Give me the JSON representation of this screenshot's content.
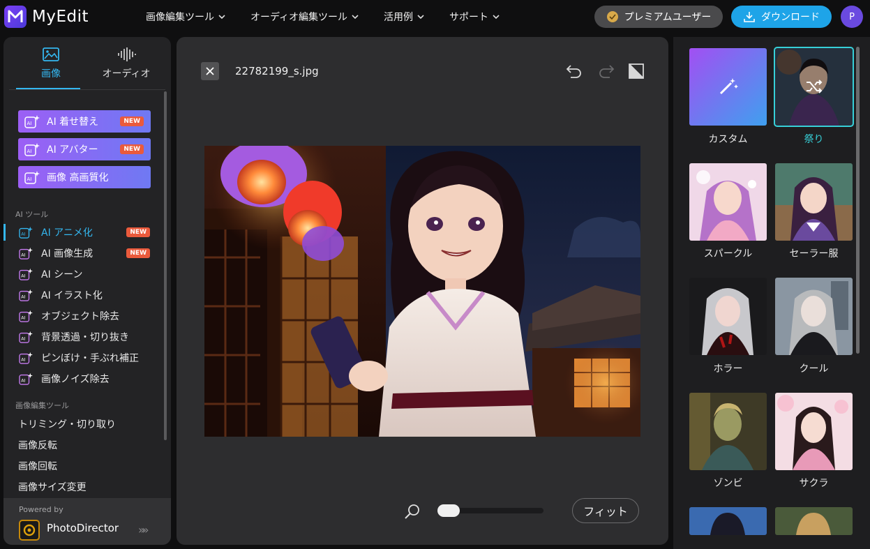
{
  "app": {
    "name": "MyEdit"
  },
  "nav": {
    "items": [
      {
        "label": "画像編集ツール"
      },
      {
        "label": "オーディオ編集ツール"
      },
      {
        "label": "活用例"
      },
      {
        "label": "サポート"
      }
    ],
    "premium_label": "プレミアムユーザー",
    "download_label": "ダウンロード",
    "avatar_initial": "P"
  },
  "sidebar": {
    "tabs": [
      {
        "label": "画像"
      },
      {
        "label": "オーディオ"
      }
    ],
    "featured": [
      {
        "label": "AI 着せ替え",
        "badge": "NEW"
      },
      {
        "label": "AI アバター",
        "badge": "NEW"
      },
      {
        "label": "画像 高画質化"
      }
    ],
    "ai_tools_label": "AI ツール",
    "ai_tools": [
      {
        "label": "AI アニメ化",
        "badge": "NEW"
      },
      {
        "label": "AI 画像生成",
        "badge": "NEW"
      },
      {
        "label": "AI シーン"
      },
      {
        "label": "AI イラスト化"
      },
      {
        "label": "オブジェクト除去"
      },
      {
        "label": "背景透過・切り抜き"
      },
      {
        "label": "ピンぼけ・手ぶれ補正"
      },
      {
        "label": "画像ノイズ除去"
      }
    ],
    "edit_tools_label": "画像編集ツール",
    "edit_tools": [
      {
        "label": "トリミング・切り取り"
      },
      {
        "label": "画像反転"
      },
      {
        "label": "画像回転"
      },
      {
        "label": "画像サイズ変更"
      }
    ],
    "powered_by": "Powered by",
    "powered_product": "PhotoDirector",
    "powered_arrow": "»»"
  },
  "canvas": {
    "file_name": "22782199_s.jpg",
    "fit_label": "フィット"
  },
  "styles": [
    {
      "label": "カスタム"
    },
    {
      "label": "祭り"
    },
    {
      "label": "スパークル"
    },
    {
      "label": "セーラー服"
    },
    {
      "label": "ホラー"
    },
    {
      "label": "クール"
    },
    {
      "label": "ゾンビ"
    },
    {
      "label": "サクラ"
    }
  ],
  "colors": {
    "accent": "#34b7f0",
    "selected": "#37d0d8",
    "download": "#1ea4e8",
    "badge": "#ea5a3c"
  }
}
